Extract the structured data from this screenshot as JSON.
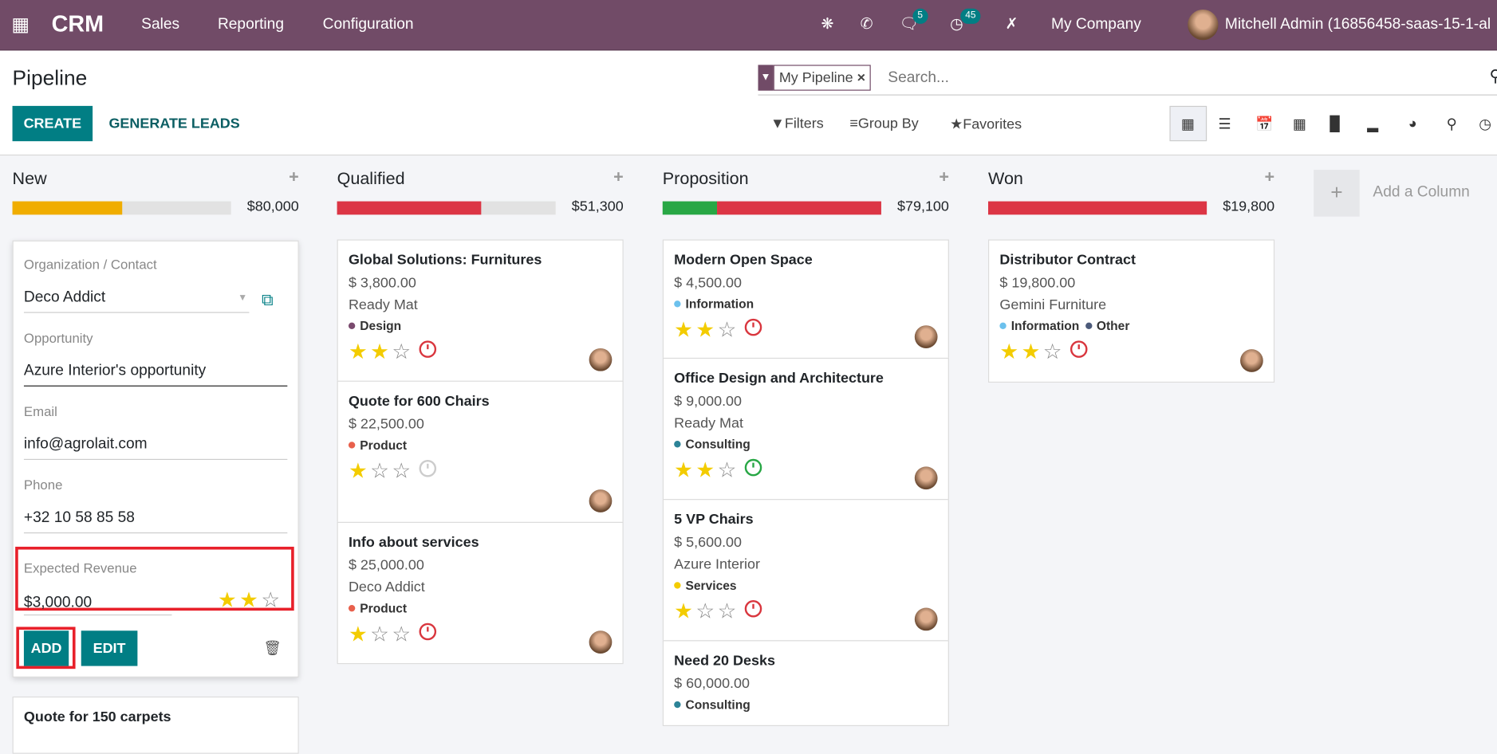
{
  "navbar": {
    "app": "CRM",
    "menus": [
      "Sales",
      "Reporting",
      "Configuration"
    ],
    "messages_count": "5",
    "activities_count": "45",
    "company": "My Company",
    "user": "Mitchell Admin (16856458-saas-15-1-al"
  },
  "control": {
    "title": "Pipeline",
    "facet": "My Pipeline",
    "search_placeholder": "Search...",
    "create": "CREATE",
    "generate": "GENERATE LEADS",
    "filters": "Filters",
    "group_by": "Group By",
    "favorites": "Favorites"
  },
  "colors": {
    "brand": "#714B67",
    "primary": "#017E84",
    "danger": "#d9363e",
    "warning": "#f0ad00",
    "success": "#28a745"
  },
  "columns": [
    {
      "name": "New",
      "total": "$80,000",
      "progress": {
        "warning": 50
      }
    },
    {
      "name": "Qualified",
      "total": "$51,300",
      "progress": {
        "danger": 66
      }
    },
    {
      "name": "Proposition",
      "total": "$79,100",
      "progress": {
        "success": 25,
        "danger": 75
      }
    },
    {
      "name": "Won",
      "total": "$19,800",
      "progress": {
        "danger": 100
      }
    }
  ],
  "add_column": "Add a Column",
  "quick_create": {
    "org_label": "Organization / Contact",
    "org": "Deco Addict",
    "opp_label": "Opportunity",
    "opp": "Azure Interior's opportunity",
    "email_label": "Email",
    "email": "info@agrolait.com",
    "phone_label": "Phone",
    "phone": "+32 10 58 85 58",
    "rev_label": "Expected Revenue",
    "rev": "$3,000.00",
    "priority": 2,
    "add": "ADD",
    "edit": "EDIT"
  },
  "new_next_card": "Quote for 150 carpets",
  "cards": {
    "qualified": [
      {
        "title": "Global Solutions: Furnitures",
        "amount": "$ 3,800.00",
        "customer": "Ready Mat",
        "tags": [
          {
            "name": "Design",
            "color": "#7a4a6e"
          }
        ],
        "priority": 2,
        "activity": "overdue"
      },
      {
        "title": "Quote for 600 Chairs",
        "amount": "$ 22,500.00",
        "tags": [
          {
            "name": "Product",
            "color": "#e8604c"
          }
        ],
        "priority": 1,
        "activity": "none"
      },
      {
        "title": "Info about services",
        "amount": "$ 25,000.00",
        "customer": "Deco Addict",
        "tags": [
          {
            "name": "Product",
            "color": "#e8604c"
          }
        ],
        "priority": 1,
        "activity": "overdue"
      }
    ],
    "proposition": [
      {
        "title": "Modern Open Space",
        "amount": "$ 4,500.00",
        "tags": [
          {
            "name": "Information",
            "color": "#6cc1ed"
          }
        ],
        "priority": 2,
        "activity": "overdue"
      },
      {
        "title": "Office Design and Architecture",
        "amount": "$ 9,000.00",
        "customer": "Ready Mat",
        "tags": [
          {
            "name": "Consulting",
            "color": "#2c8397"
          }
        ],
        "priority": 2,
        "activity": "planned"
      },
      {
        "title": "5 VP Chairs",
        "amount": "$ 5,600.00",
        "customer": "Azure Interior",
        "tags": [
          {
            "name": "Services",
            "color": "#f3cc00"
          }
        ],
        "priority": 1,
        "activity": "overdue"
      },
      {
        "title": "Need 20 Desks",
        "amount": "$ 60,000.00",
        "tags": [
          {
            "name": "Consulting",
            "color": "#2c8397"
          }
        ]
      }
    ],
    "won": [
      {
        "title": "Distributor Contract",
        "amount": "$ 19,800.00",
        "customer": "Gemini Furniture",
        "tags": [
          {
            "name": "Information",
            "color": "#6cc1ed"
          },
          {
            "name": "Other",
            "color": "#4c5a7a"
          }
        ],
        "priority": 2,
        "activity": "overdue"
      }
    ]
  }
}
